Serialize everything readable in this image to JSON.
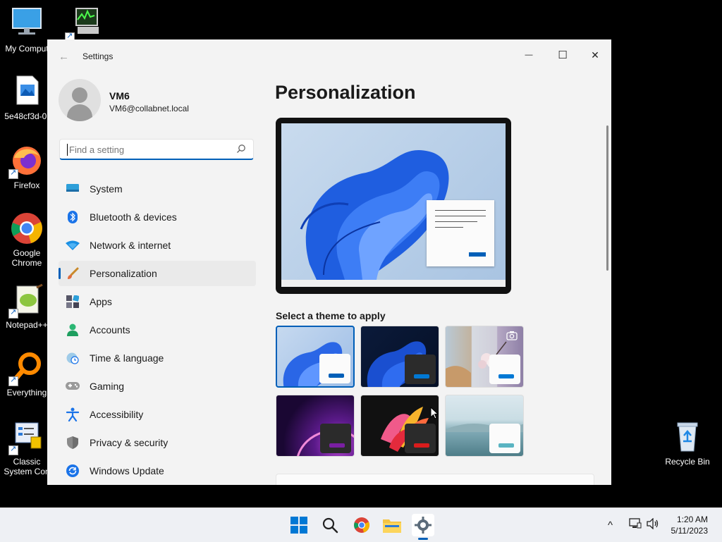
{
  "desktop": {
    "icons": [
      {
        "label": "My Comput"
      },
      {
        "label": ""
      },
      {
        "label": "5e48cf3d-0."
      },
      {
        "label": "Firefox"
      },
      {
        "label": "Google Chrome"
      },
      {
        "label": "Notepad++"
      },
      {
        "label": "Everything"
      },
      {
        "label": "Classic System Con"
      },
      {
        "label": "Recycle Bin"
      }
    ]
  },
  "window": {
    "title": "Settings",
    "controls": {
      "minimize": "—",
      "maximize": "☐",
      "close": "✕"
    }
  },
  "profile": {
    "name": "VM6",
    "email": "VM6@collabnet.local"
  },
  "search": {
    "placeholder": "Find a setting"
  },
  "nav": {
    "items": [
      {
        "label": "System",
        "icon": "system-icon"
      },
      {
        "label": "Bluetooth & devices",
        "icon": "bluetooth-icon"
      },
      {
        "label": "Network & internet",
        "icon": "wifi-icon"
      },
      {
        "label": "Personalization",
        "icon": "brush-icon",
        "selected": true
      },
      {
        "label": "Apps",
        "icon": "apps-icon"
      },
      {
        "label": "Accounts",
        "icon": "accounts-icon"
      },
      {
        "label": "Time & language",
        "icon": "clock-globe-icon"
      },
      {
        "label": "Gaming",
        "icon": "gamepad-icon"
      },
      {
        "label": "Accessibility",
        "icon": "accessibility-icon"
      },
      {
        "label": "Privacy & security",
        "icon": "shield-icon"
      },
      {
        "label": "Windows Update",
        "icon": "update-icon"
      }
    ]
  },
  "main": {
    "title": "Personalization",
    "theme_label": "Select a theme to apply",
    "themes": [
      {
        "name": "windows-light",
        "selected": true,
        "accent": "#005fb8"
      },
      {
        "name": "windows-dark",
        "accent": "#0078d4"
      },
      {
        "name": "captured-motion",
        "accent": "#0078d4"
      },
      {
        "name": "glow",
        "accent": "#7a1fa2"
      },
      {
        "name": "sunrise",
        "accent": "#d91c1c"
      },
      {
        "name": "flow",
        "accent": "#5ab4c2"
      }
    ]
  },
  "taskbar": {
    "clock": {
      "time": "1:20 AM",
      "date": "5/11/2023"
    },
    "tray": {
      "chevron": "^"
    }
  },
  "colors": {
    "accent": "#005fb8"
  }
}
